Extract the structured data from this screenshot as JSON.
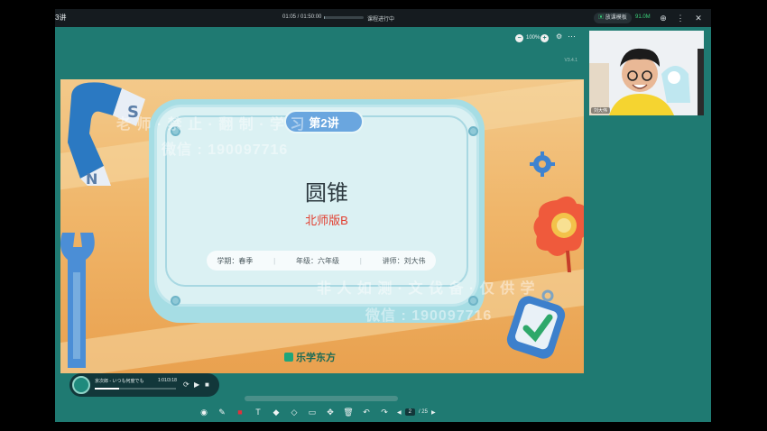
{
  "topbar": {
    "title": "3讲",
    "time": "01:05  /  01:50:00",
    "progress": 0.0098,
    "status": "课程进行中",
    "pill": "放课模板",
    "pill_value": "91.0M",
    "icons": [
      "zoom-icon",
      "more-icon",
      "close-icon"
    ]
  },
  "stage": {
    "zoom_minus": "−",
    "zoom_value": "100%",
    "zoom_plus": "+",
    "version": "V3.4.1"
  },
  "slide": {
    "badge": "第2讲",
    "title": "圆锥",
    "subtitle": "北师版B",
    "info": [
      "学期：春季",
      "年级：六年级",
      "讲师：刘大伟"
    ],
    "brand": "乐学东方",
    "watermark_line1": "老 师 · 禁 止 · 翻 制 · 学 习",
    "watermark_qq1": "微信 : 190097716",
    "watermark_line2": "非 人 如 测 · 文 伐 备 · 仅 供 学",
    "watermark_qq2": "微信 : 190097716"
  },
  "player": {
    "song": "京次郎 - いつも何度でも",
    "time": "1:01/3:18",
    "progress": 0.3
  },
  "pager": {
    "current": "2",
    "total": "/ 25"
  },
  "video": {
    "caption": "刘大伟"
  },
  "colors": {
    "accent": "#1f7a72",
    "topbar": "#151b1f",
    "title_red": "#e23c2d",
    "badge_blue": "#6aa6df"
  }
}
